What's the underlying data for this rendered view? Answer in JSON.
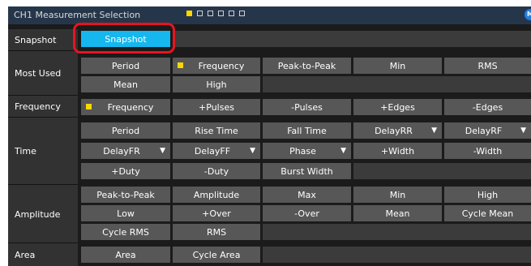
{
  "title": "CH1 Measurement Selection",
  "corner_icon": "M",
  "page_dots": [
    "filled",
    "empty",
    "empty",
    "empty",
    "empty",
    "empty"
  ],
  "rows": {
    "snapshot": {
      "label": "Snapshot",
      "buttons": [
        "Snapshot"
      ]
    },
    "most_used": {
      "label": "Most Used",
      "buttons": [
        "Period",
        "Frequency",
        "Peak-to-Peak",
        "Min",
        "RMS",
        "Mean",
        "High"
      ]
    },
    "frequency": {
      "label": "Frequency",
      "buttons": [
        "Frequency",
        "+Pulses",
        "-Pulses",
        "+Edges",
        "-Edges"
      ]
    },
    "time": {
      "label": "Time",
      "buttons": [
        "Period",
        "Rise Time",
        "Fall Time",
        "DelayRR",
        "DelayRF",
        "DelayFR",
        "DelayFF",
        "Phase",
        "+Width",
        "-Width",
        "+Duty",
        "-Duty",
        "Burst Width"
      ]
    },
    "amplitude": {
      "label": "Amplitude",
      "buttons": [
        "Peak-to-Peak",
        "Amplitude",
        "Max",
        "Min",
        "High",
        "Low",
        "+Over",
        "-Over",
        "Mean",
        "Cycle Mean",
        "Cycle RMS",
        "RMS"
      ]
    },
    "area": {
      "label": "Area",
      "buttons": [
        "Area",
        "Cycle Area"
      ]
    }
  },
  "colors": {
    "accent": "#15b7ee",
    "selected_marker": "#ffd700",
    "highlight_border": "#e8141e",
    "button": "#575757",
    "titlebar": "#26364a"
  }
}
